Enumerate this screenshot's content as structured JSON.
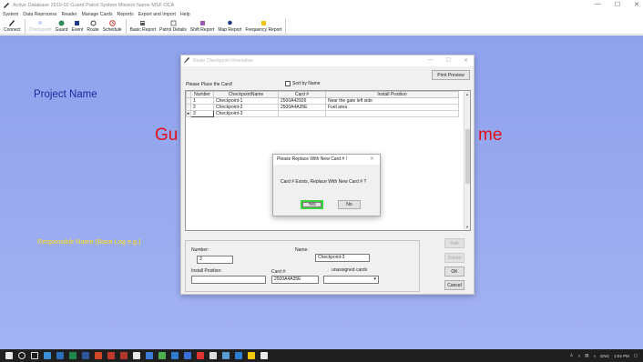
{
  "app": {
    "title": "Active Database 2019-02 Guard Patrol System Mission Name  MSF OCA",
    "window_controls": [
      "—",
      "☐",
      "✕"
    ]
  },
  "menu": [
    "System",
    "Data Reprocess",
    "Reader",
    "Manage Cards",
    "Reports",
    "Export and Import",
    "Help"
  ],
  "toolbar": [
    {
      "label": "Connect",
      "icon": "pen-icon",
      "enabled": true
    },
    {
      "label": "Checkpoint",
      "icon": "checkpoint-icon",
      "enabled": false
    },
    {
      "label": "Guard",
      "icon": "guard-icon",
      "enabled": true
    },
    {
      "label": "Event",
      "icon": "event-icon",
      "enabled": true
    },
    {
      "label": "Route",
      "icon": "route-icon",
      "enabled": true
    },
    {
      "label": "Schedule",
      "icon": "schedule-icon",
      "enabled": true
    },
    {
      "label": "Basic Report",
      "icon": "basic-report-icon",
      "enabled": true
    },
    {
      "label": "Patrol Details",
      "icon": "patrol-details-icon",
      "enabled": true
    },
    {
      "label": "Shift Report",
      "icon": "shift-report-icon",
      "enabled": true
    },
    {
      "label": "Map Report",
      "icon": "map-report-icon",
      "enabled": true
    },
    {
      "label": "Frequency Report",
      "icon": "frequency-report-icon",
      "enabled": true
    }
  ],
  "background": {
    "project_name": "Project Name",
    "title_left": "Gu",
    "title_right": "me",
    "responsible_name": "Responsible Name (Base Log e.g.)"
  },
  "dialog": {
    "title": "Route Checkpoint Information",
    "window_controls": [
      "—",
      "☐",
      "✕"
    ],
    "print_preview": "Print Preview",
    "place_card_label": "Please Place the Card!",
    "sort_by_name": "Sort by Name",
    "columns": [
      "Number",
      "CheckpointName",
      "Card #",
      "Install Position"
    ],
    "rows": [
      [
        "1",
        "Checkpoint-1",
        "2500A42926",
        "Near the gate left side"
      ],
      [
        "2",
        "Checkpoint-2",
        "2500A4A35E",
        "Fuel area"
      ],
      [
        "3",
        "Checkpoint-3",
        "",
        ""
      ]
    ],
    "number_label": "Number:",
    "number_value": "3",
    "name_label": "Name:",
    "name_value": "Checkpoint-3",
    "install_label": "Install Position:",
    "install_value": "",
    "card_label": "Card #:",
    "card_value": "2500A4A35E",
    "unassigned_label": "unassigned cards",
    "unassigned_value": "",
    "btn_add": "Add",
    "btn_delete": "Delete",
    "btn_ok": "OK",
    "btn_cancel": "Cancel"
  },
  "modal": {
    "title": "Please Replace With New Card # !",
    "close": "✕",
    "message": "Card # Exists, Replace With New Card # ?",
    "yes": "Yes",
    "no": "No"
  },
  "taskbar": {
    "language": "ENG",
    "time": "1:04 PM"
  },
  "colors": {
    "desktop": "#98a9ee",
    "project_name": "#1a2ca0",
    "title_red": "#e0111b",
    "responsible_yellow": "#ffe21a",
    "focus_green": "#3fd43f"
  }
}
